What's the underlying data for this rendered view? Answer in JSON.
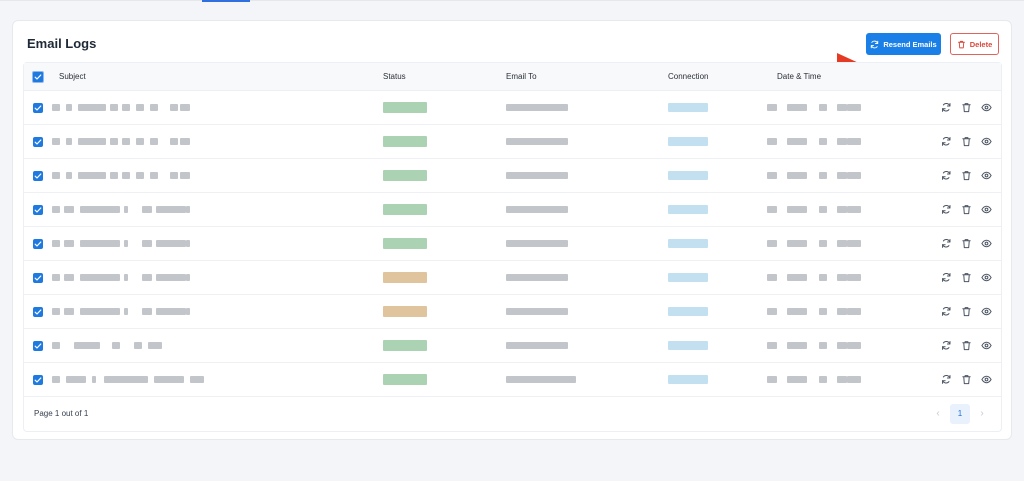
{
  "card": {
    "title": "Email Logs",
    "resend_label": "Resend Emails",
    "delete_label": "Delete"
  },
  "table": {
    "columns": [
      "Subject",
      "Status",
      "Email To",
      "Connection",
      "Date & Time"
    ],
    "rows": [
      {
        "selected": true,
        "status": "success"
      },
      {
        "selected": true,
        "status": "success"
      },
      {
        "selected": true,
        "status": "success"
      },
      {
        "selected": true,
        "status": "success"
      },
      {
        "selected": true,
        "status": "success"
      },
      {
        "selected": true,
        "status": "warning"
      },
      {
        "selected": true,
        "status": "warning"
      },
      {
        "selected": true,
        "status": "success"
      },
      {
        "selected": true,
        "status": "success"
      }
    ],
    "row_actions": [
      "resend-icon",
      "trash-icon",
      "eye-icon"
    ]
  },
  "pagination": {
    "info": "Page 1 out of 1",
    "current_page": "1",
    "prev_glyph": "‹",
    "next_glyph": "›"
  },
  "colors": {
    "primary": "#1a7fe6",
    "danger": "#d9473d",
    "arrow": "#e53a23",
    "status_success": "#8fc49a",
    "status_warning": "#d5b07d",
    "connection": "#a9d3ea",
    "redacted": "#c2c5ca"
  }
}
